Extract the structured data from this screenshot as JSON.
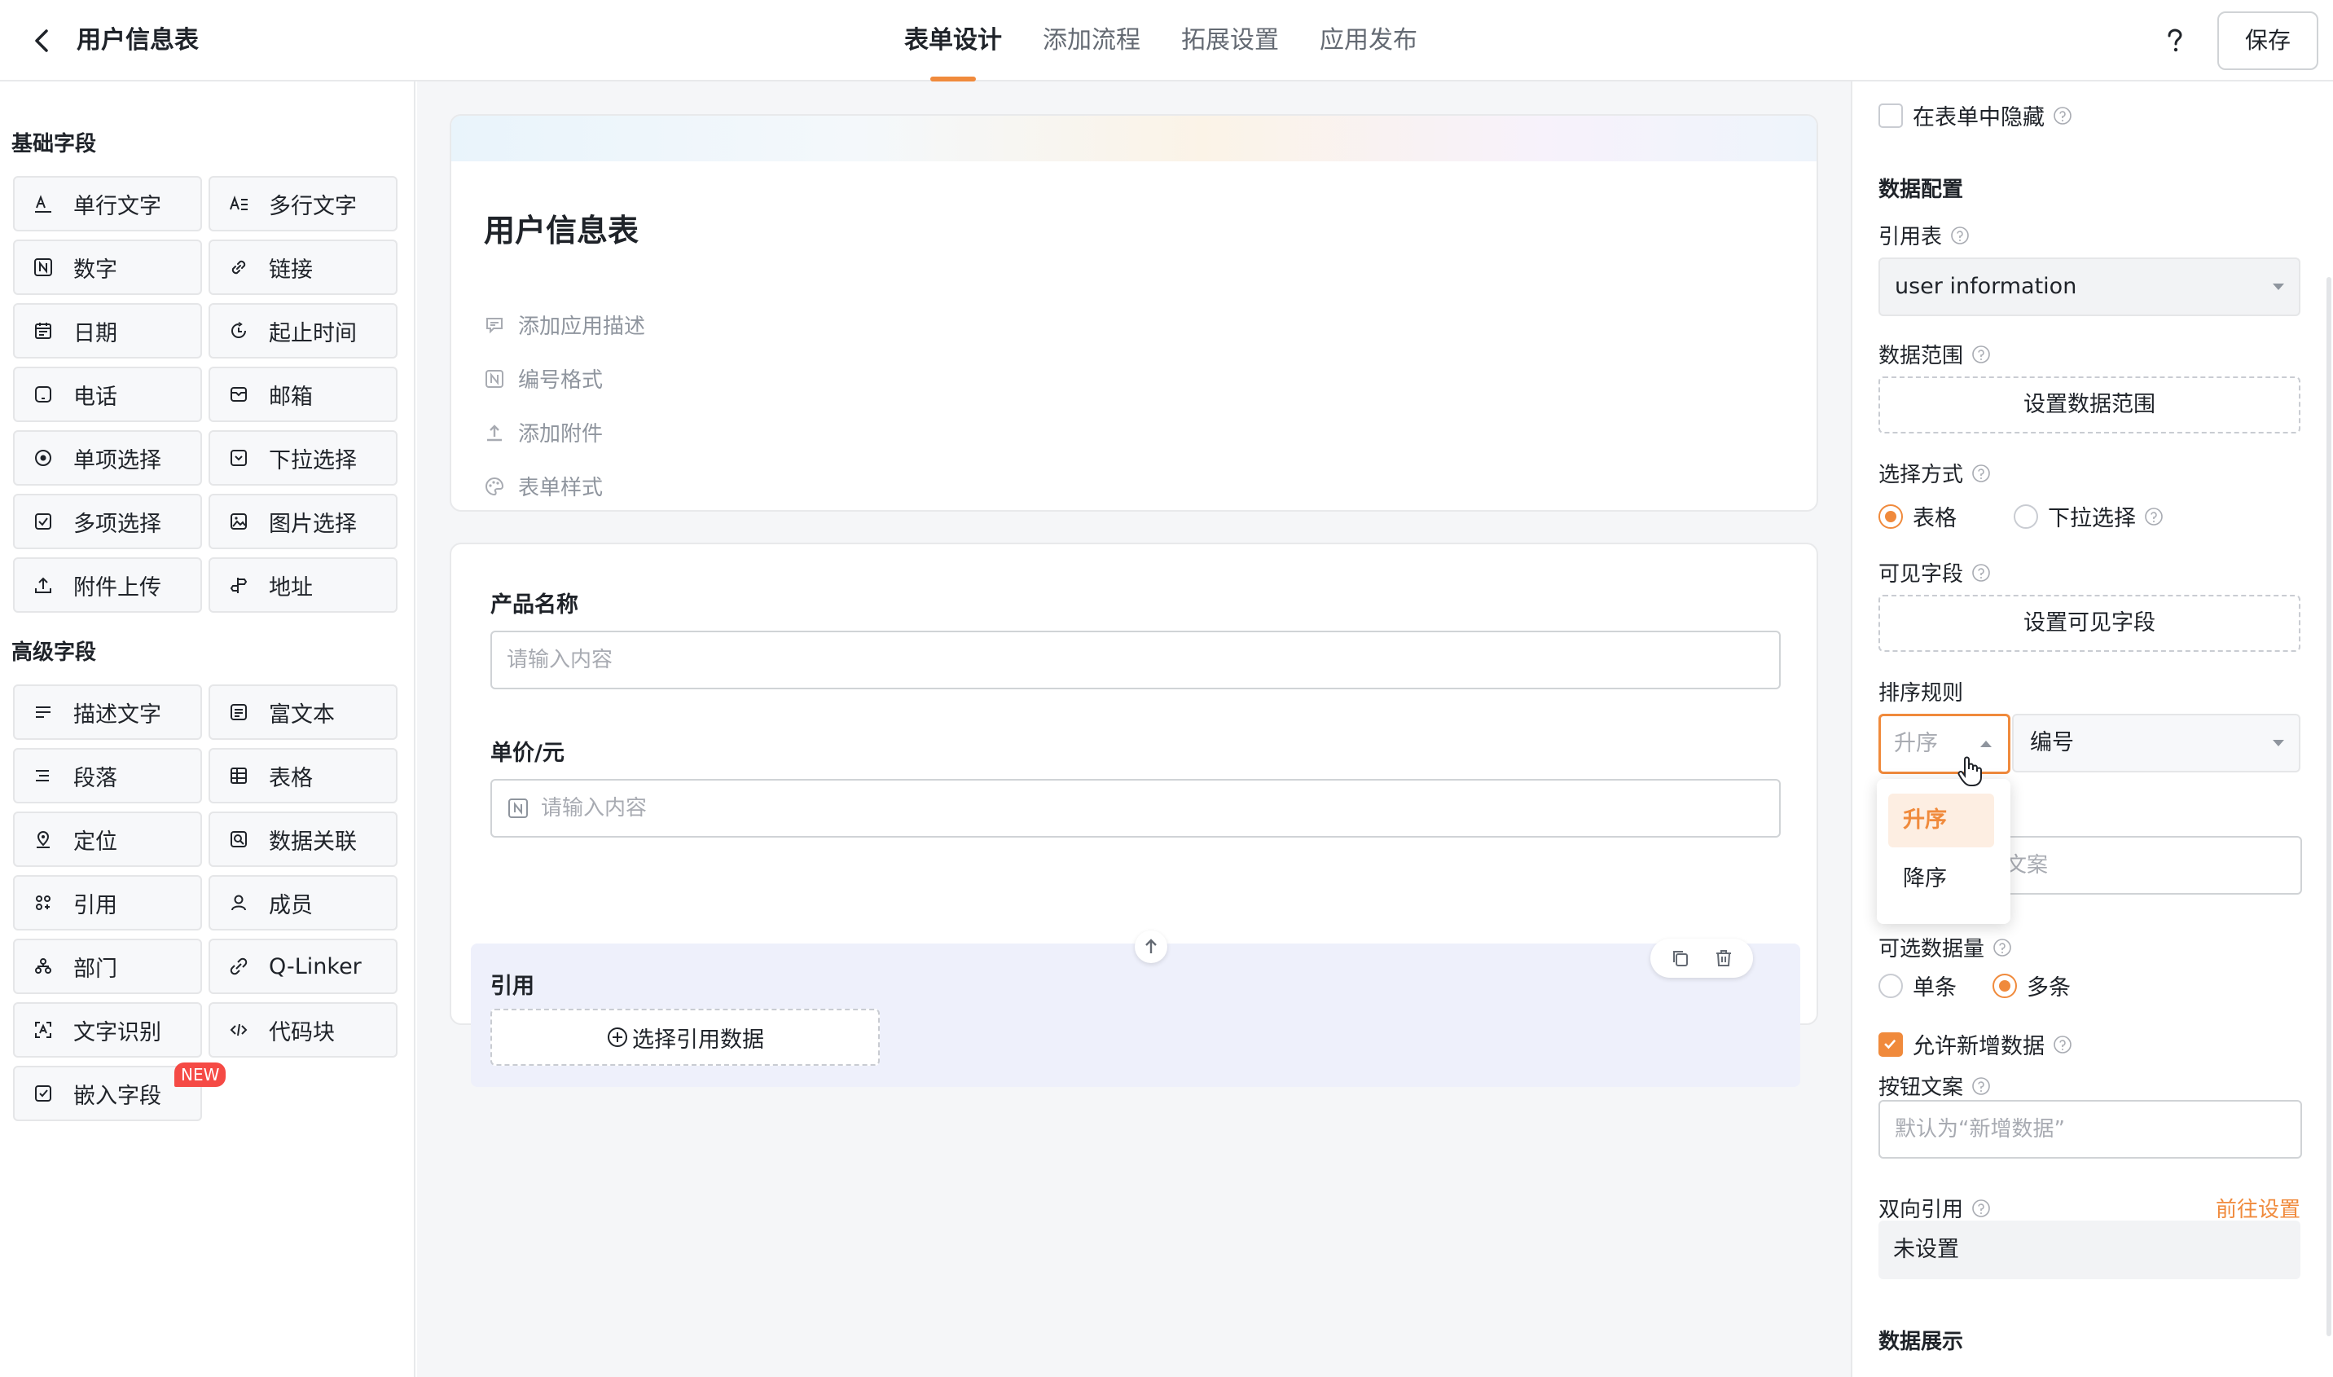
{
  "header": {
    "title": "用户信息表",
    "tabs": [
      "表单设计",
      "添加流程",
      "拓展设置",
      "应用发布"
    ],
    "active_tab": 0,
    "save_label": "保存",
    "help_icon": "question-icon"
  },
  "left": {
    "basic_title": "基础字段",
    "basic_fields": [
      {
        "label": "单行文字",
        "icon": "text-line-icon"
      },
      {
        "label": "多行文字",
        "icon": "text-multiline-icon"
      },
      {
        "label": "数字",
        "icon": "number-icon"
      },
      {
        "label": "链接",
        "icon": "link-icon"
      },
      {
        "label": "日期",
        "icon": "calendar-icon"
      },
      {
        "label": "起止时间",
        "icon": "time-range-icon"
      },
      {
        "label": "电话",
        "icon": "phone-icon"
      },
      {
        "label": "邮箱",
        "icon": "mail-icon"
      },
      {
        "label": "单项选择",
        "icon": "radio-icon"
      },
      {
        "label": "下拉选择",
        "icon": "dropdown-icon"
      },
      {
        "label": "多项选择",
        "icon": "checkbox-icon"
      },
      {
        "label": "图片选择",
        "icon": "image-icon"
      },
      {
        "label": "附件上传",
        "icon": "upload-icon"
      },
      {
        "label": "地址",
        "icon": "signpost-icon"
      }
    ],
    "advanced_title": "高级字段",
    "advanced_fields": [
      {
        "label": "描述文字",
        "icon": "description-icon"
      },
      {
        "label": "富文本",
        "icon": "richtext-icon"
      },
      {
        "label": "段落",
        "icon": "paragraph-icon"
      },
      {
        "label": "表格",
        "icon": "table-icon"
      },
      {
        "label": "定位",
        "icon": "location-icon"
      },
      {
        "label": "数据关联",
        "icon": "data-link-icon"
      },
      {
        "label": "引用",
        "icon": "reference-icon"
      },
      {
        "label": "成员",
        "icon": "member-icon"
      },
      {
        "label": "部门",
        "icon": "department-icon"
      },
      {
        "label": "Q-Linker",
        "icon": "qlinker-icon"
      },
      {
        "label": "文字识别",
        "icon": "ocr-icon"
      },
      {
        "label": "代码块",
        "icon": "code-icon"
      },
      {
        "label": "嵌入字段",
        "icon": "embed-icon"
      }
    ],
    "new_badge": "NEW"
  },
  "form": {
    "title": "用户信息表",
    "meta": [
      {
        "label": "添加应用描述",
        "icon": "comment-icon"
      },
      {
        "label": "编号格式",
        "icon": "number-format-icon"
      },
      {
        "label": "添加附件",
        "icon": "upload-icon"
      },
      {
        "label": "表单样式",
        "icon": "palette-icon"
      }
    ],
    "fields": [
      {
        "label": "产品名称",
        "placeholder": "请输入内容"
      },
      {
        "label": "单价/元",
        "placeholder": "请输入内容"
      }
    ],
    "reference": {
      "label": "引用",
      "button": "选择引用数据"
    }
  },
  "panel": {
    "hide_in_form": "在表单中隐藏",
    "data_config_title": "数据配置",
    "ref_table_label": "引用表",
    "ref_table_value": "user information",
    "data_range_label": "数据范围",
    "data_range_button": "设置数据范围",
    "select_mode_label": "选择方式",
    "select_mode_options": [
      "表格",
      "下拉选择"
    ],
    "select_mode_selected": "表格",
    "visible_fields_label": "可见字段",
    "visible_fields_button": "设置可见字段",
    "sort_label": "排序规则",
    "sort_order_value": "升序",
    "sort_field_value": "编号",
    "sort_options": [
      "升序",
      "降序"
    ],
    "hidden_input_suffix": "文案",
    "count_label": "可选数据量",
    "count_options": [
      "单条",
      "多条"
    ],
    "count_selected": "多条",
    "allow_add_label": "允许新增数据",
    "allow_add_checked": true,
    "button_text_label": "按钮文案",
    "button_text_placeholder": "默认为“新增数据”",
    "bidirectional_label": "双向引用",
    "bidirectional_link": "前往设置",
    "bidirectional_value": "未设置",
    "display_title": "数据展示"
  },
  "colors": {
    "accent": "#f08a3c",
    "text": "#1f2329",
    "muted": "#8f959e",
    "canvas_bg": "#f5f6f8",
    "selected_bg": "#eef0fb",
    "badge": "#f54a45"
  }
}
